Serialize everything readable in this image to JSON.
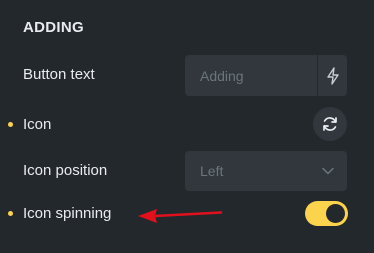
{
  "section": {
    "title": "ADDING"
  },
  "rows": {
    "button_text": {
      "label": "Button text",
      "placeholder": "Adding",
      "dynamic_icon": "bolt-icon"
    },
    "icon": {
      "label": "Icon",
      "button_icon": "refresh-icon",
      "modified": true
    },
    "icon_position": {
      "label": "Icon position",
      "selected": "Left",
      "chevron_icon": "chevron-down-icon"
    },
    "icon_spinning": {
      "label": "Icon spinning",
      "modified": true,
      "enabled": true
    }
  },
  "annotation": {
    "arrow_icon": "red-arrow-left-icon",
    "color": "#e0101c"
  },
  "colors": {
    "background": "#23282d",
    "control": "#31373d",
    "accent": "#fcd34d",
    "text": "#e9ecef",
    "muted": "#6c757d"
  }
}
